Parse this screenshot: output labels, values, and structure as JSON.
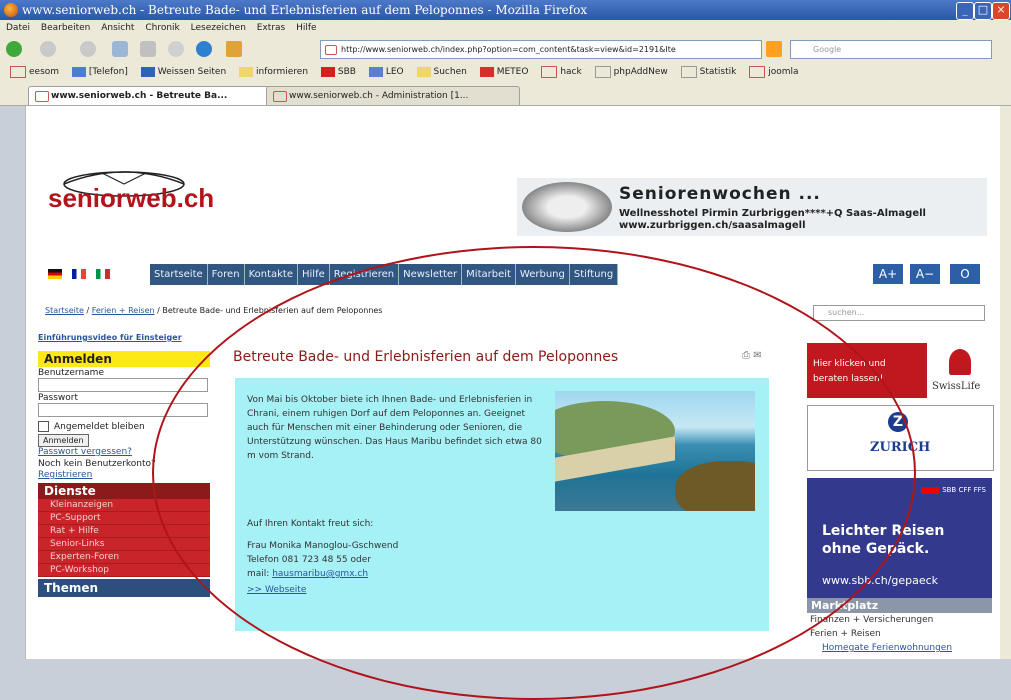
{
  "window": {
    "title": "www.seniorweb.ch - Betreute Bade- und Erlebnisferien auf dem Peloponnes - Mozilla Firefox"
  },
  "menu": [
    "Datei",
    "Bearbeiten",
    "Ansicht",
    "Chronik",
    "Lesezeichen",
    "Extras",
    "Hilfe"
  ],
  "url": "http://www.seniorweb.ch/index.php?option=com_content&task=view&id=2191&Ite",
  "search_placeholder": "Google",
  "bookmarks": [
    "eesom",
    "[Telefon]",
    "Weissen Seiten",
    "informieren",
    "SBB",
    "LEO",
    "Suchen",
    "METEO",
    "hack",
    "phpAddNew",
    "Statistik",
    "joomla"
  ],
  "tabs": [
    "www.seniorweb.ch - Betreute Ba...",
    "www.seniorweb.ch - Administration [1..."
  ],
  "site": {
    "logo": "seniorweb.ch",
    "banner": {
      "heading": "Seniorenwochen ...",
      "line1": "Wellnesshotel Pirmin Zurbriggen****+Q Saas-Almagell",
      "line2": "www.zurbriggen.ch/saasalmagell"
    },
    "nav": [
      "Startseite",
      "Foren",
      "Kontakte",
      "Hilfe",
      "Registrieren",
      "Newsletter",
      "Mitarbeit",
      "Werbung",
      "Stiftung"
    ],
    "font_buttons": [
      "A+",
      "A−",
      "O"
    ],
    "breadcrumb": {
      "home": "Startseite",
      "cat": "Ferien + Reisen",
      "current": "Betreute Bade- und Erlebnisferien auf dem Peloponnes"
    },
    "site_search_placeholder": "suchen..."
  },
  "left": {
    "tutorial": "Einführungsvideo für Einsteiger",
    "login_head": "Anmelden",
    "user_label": "Benutzername",
    "pass_label": "Passwort",
    "remember": "Angemeldet bleiben",
    "login_btn": "Anmelden",
    "forgot": "Passwort vergessen?",
    "no_account": "Noch kein Benutzerkonto?",
    "register": "Registrieren",
    "dienste_head": "Dienste",
    "dienste": [
      "Kleinanzeigen",
      "PC-Support",
      "Rat + Hilfe",
      "Senior-Links",
      "Experten-Foren",
      "PC-Workshop"
    ],
    "themen_head": "Themen"
  },
  "article": {
    "title": "Betreute Bade- und Erlebnisferien auf dem Peloponnes",
    "body": "Von Mai bis Oktober biete ich Ihnen Bade- und Erlebnisferien in Chrani, einem ruhigen Dorf auf dem Peloponnes an. Geeignet auch für Menschen mit einer Behinderung oder Senioren, die Unterstützung wünschen. Das Haus Maribu befindet sich etwa 80 m vom Strand.",
    "contact_intro": "Auf Ihren Kontakt freut sich:",
    "name": "Frau Monika Manoglou-Gschwend",
    "phone": "Telefon 081 723 48 55 oder",
    "mail_label": "mail:",
    "mail": "hausmaribu@gmx.ch",
    "website": ">> Webseite"
  },
  "ads": {
    "swisslife_text1": "Hier klicken und",
    "swisslife_text2": "beraten lassen!",
    "swisslife": "SwissLife",
    "zurich": "ZURICH",
    "sbb_logo": "SBB CFF FFS",
    "sbb_line1": "Leichter Reisen",
    "sbb_line2": "ohne Gepäck.",
    "sbb_url": "www.sbb.ch/gepaeck"
  },
  "markt": {
    "head": "Marktplatz",
    "l1": "Finanzen + Versicherungen",
    "l2": "Ferien + Reisen",
    "l3": "Homegate Ferienwohnungen"
  }
}
